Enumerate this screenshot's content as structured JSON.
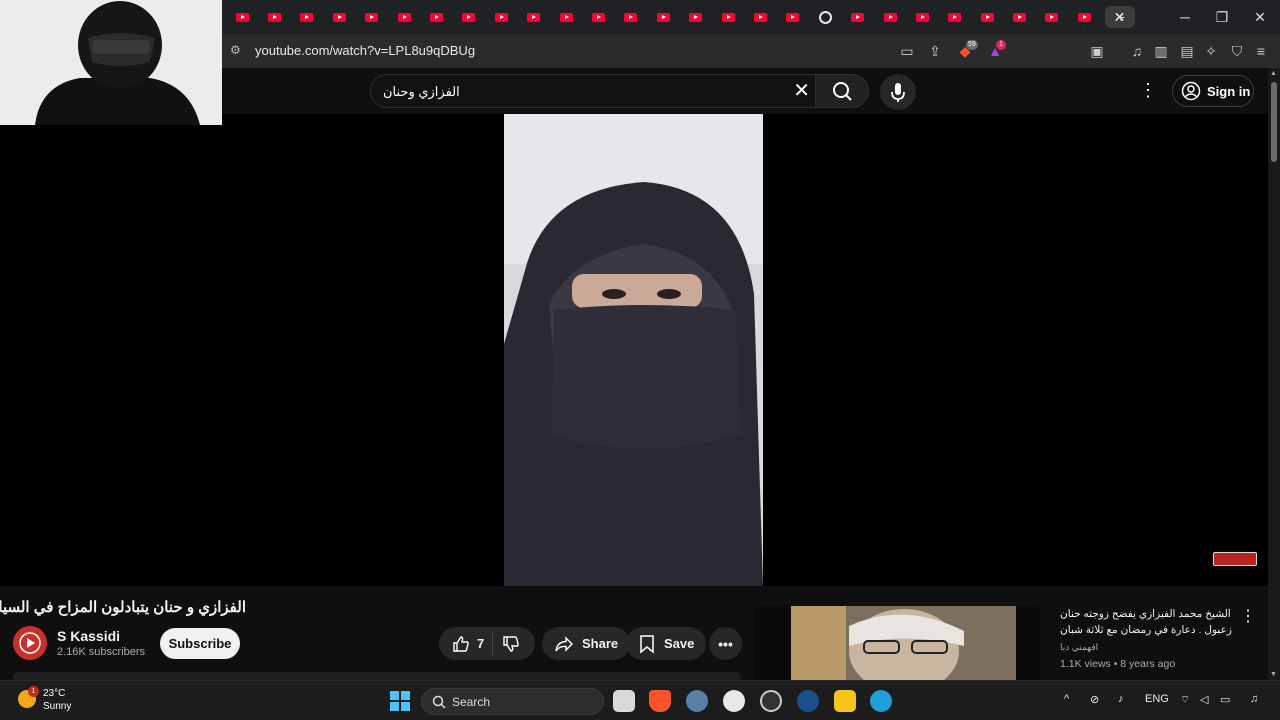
{
  "browser": {
    "tab_count_youtube": 26,
    "active_tab_close": "✕",
    "new_tab": "+",
    "url": "youtube.com/watch?v=LPL8u9qDBUg",
    "badges": {
      "brave_shields": "59",
      "rewards": "1"
    }
  },
  "youtube": {
    "search": {
      "query": "الفزازي وحنان"
    },
    "signin_label": "Sign in"
  },
  "video": {
    "title": "الفزازي و حنان يتبادلون المزاح في السيارة",
    "channel": {
      "name": "S Kassidi",
      "subscribers": "2.16K subscribers"
    },
    "subscribe_label": "Subscribe",
    "likes": "7",
    "share_label": "Share",
    "save_label": "Save"
  },
  "recommended": [
    {
      "title": "الشيخ محمد الفيزازي يفضح زوجته حنان زعبول . دعارة في رمضان مع ثلاثة شبان",
      "channel": "افهمني دبا",
      "views": "1.1K views",
      "age": "8 years ago"
    }
  ],
  "taskbar": {
    "weather": {
      "temp": "23°C",
      "condition": "Sunny",
      "badge": "1"
    },
    "search_label": "Search",
    "language": "ENG"
  },
  "colors": {
    "youtube_red": "#ff0033",
    "accent_blue": "#4cc2ff",
    "dark_bg": "#0f0f0f"
  }
}
